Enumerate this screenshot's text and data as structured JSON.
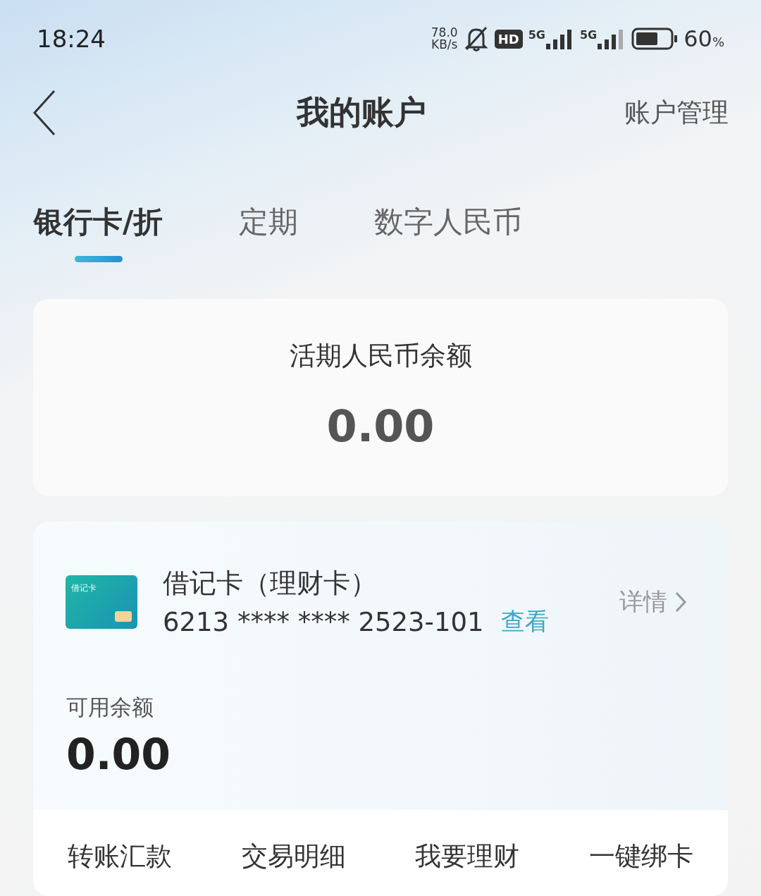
{
  "status_bar": {
    "time": "18:24",
    "net_speed": "78.0",
    "net_unit": "KB/s",
    "hd": "HD",
    "sim1": "5G",
    "sim2": "5G",
    "battery": "60",
    "battery_unit": "%"
  },
  "header": {
    "title": "我的账户",
    "action": "账户管理"
  },
  "tabs": [
    {
      "label": "银行卡/折",
      "selected": true
    },
    {
      "label": "定期",
      "selected": false
    },
    {
      "label": "数字人民币",
      "selected": false
    }
  ],
  "summary": {
    "label": "活期人民币余额",
    "amount": "0.00"
  },
  "account": {
    "card_label": "借记卡",
    "name": "借记卡（理财卡）",
    "number": "6213 **** **** 2523-101",
    "view": "查看",
    "details": "详情",
    "balance_label": "可用余额",
    "balance": "0.00"
  },
  "actions": [
    "转账汇款",
    "交易明细",
    "我要理财",
    "一键绑卡"
  ]
}
